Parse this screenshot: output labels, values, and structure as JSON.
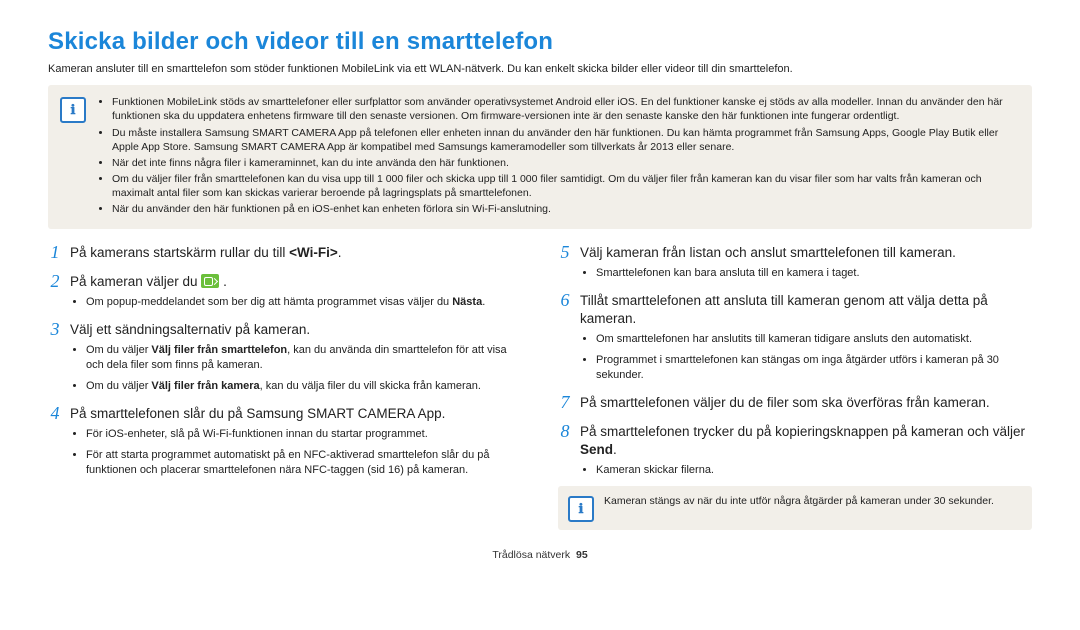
{
  "page_title": "Skicka bilder och videor till en smarttelefon",
  "intro": "Kameran ansluter till en smarttelefon som stöder funktionen MobileLink via ett WLAN-nätverk. Du kan enkelt skicka bilder eller videor till din smarttelefon.",
  "notice_icon_label": "ℹ",
  "notice_items": [
    "Funktionen MobileLink stöds av smarttelefoner eller surfplattor som använder operativsystemet Android eller iOS. En del funktioner kanske ej stöds av alla modeller. Innan du använder den här funktionen ska du uppdatera enhetens firmware till den senaste versionen. Om firmware-versionen inte är den senaste kanske den här funktionen inte fungerar ordentligt.",
    "Du måste installera Samsung SMART CAMERA App på telefonen eller enheten innan du använder den här funktionen. Du kan hämta programmet från Samsung Apps, Google Play Butik eller Apple App Store. Samsung SMART CAMERA App är kompatibel med Samsungs kameramodeller som tillverkats år 2013 eller senare.",
    "När det inte finns några filer i kameraminnet, kan du inte använda den här funktionen.",
    "Om du väljer filer från smarttelefonen kan du visa upp till 1 000 filer och skicka upp till 1 000 filer samtidigt. Om du väljer filer från kameran kan du visar filer som har valts från kameran och maximalt antal filer som kan skickas varierar beroende på lagringsplats på smarttelefonen.",
    "När du använder den här funktionen på en iOS-enhet kan enheten förlora sin Wi-Fi-anslutning."
  ],
  "steps": {
    "s1": {
      "num": "1",
      "title_pre": "På kamerans startskärm rullar du till ",
      "title_bold": "<Wi-Fi>",
      "title_post": "."
    },
    "s2": {
      "num": "2",
      "title_pre": "På kameran väljer du ",
      "title_post": " .",
      "sub": [
        "Om popup-meddelandet som ber dig att hämta programmet visas väljer du "
      ],
      "sub_bold": "Nästa",
      "sub_post": "."
    },
    "s3": {
      "num": "3",
      "title": "Välj ett sändningsalternativ på kameran.",
      "sub1_pre": "Om du väljer ",
      "sub1_bold": "Välj filer från smarttelefon",
      "sub1_post": ", kan du använda din smarttelefon för att visa och dela filer som finns på kameran.",
      "sub2_pre": "Om du väljer ",
      "sub2_bold": "Välj filer från kamera",
      "sub2_post": ", kan du välja filer du vill skicka från kameran."
    },
    "s4": {
      "num": "4",
      "title": "På smarttelefonen slår du på Samsung SMART CAMERA App.",
      "sub": [
        "För iOS-enheter, slå på Wi-Fi-funktionen innan du startar programmet.",
        "För att starta programmet automatiskt på en NFC-aktiverad smarttelefon slår du på funktionen och placerar smarttelefonen nära NFC-taggen (sid 16) på kameran."
      ]
    },
    "s5": {
      "num": "5",
      "title": "Välj kameran från listan och anslut smarttelefonen till kameran.",
      "sub": [
        "Smarttelefonen kan bara ansluta till en kamera i taget."
      ]
    },
    "s6": {
      "num": "6",
      "title": "Tillåt smarttelefonen att ansluta till kameran genom att välja detta på kameran.",
      "sub": [
        "Om smarttelefonen har anslutits till kameran tidigare ansluts den automatiskt.",
        "Programmet i smarttelefonen kan stängas om inga åtgärder utförs i kameran på 30 sekunder."
      ]
    },
    "s7": {
      "num": "7",
      "title": "På smarttelefonen väljer du de filer som ska överföras från kameran."
    },
    "s8": {
      "num": "8",
      "title_pre": "På smarttelefonen trycker du på kopieringsknappen på kameran och väljer ",
      "title_bold": "Send",
      "title_post": ".",
      "sub": [
        "Kameran skickar filerna."
      ],
      "note": "Kameran stängs av när du inte utför några åtgärder på kameran under 30 sekunder."
    }
  },
  "footer_label": "Trådlösa nätverk",
  "footer_page": "95"
}
